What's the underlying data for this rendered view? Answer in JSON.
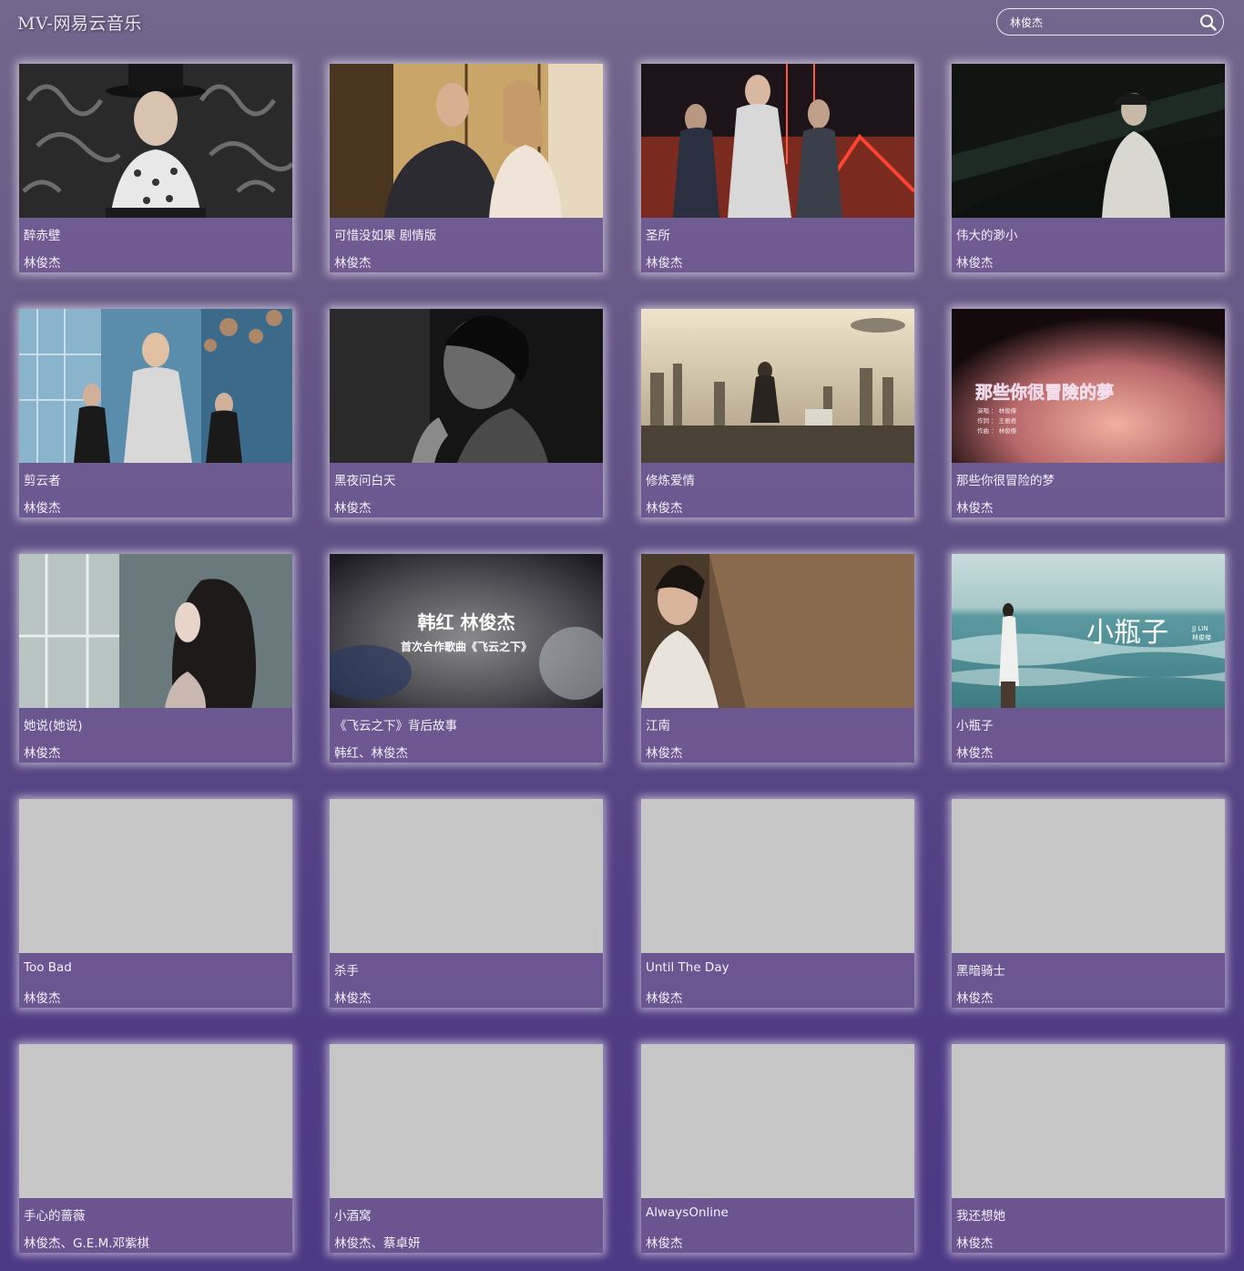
{
  "app": {
    "title": "MV-网易云音乐"
  },
  "search": {
    "value": "林俊杰",
    "placeholder": ""
  },
  "mvs": [
    {
      "title": "醉赤壁",
      "artist": "林俊杰"
    },
    {
      "title": "可惜没如果 剧情版",
      "artist": "林俊杰"
    },
    {
      "title": "圣所",
      "artist": "林俊杰"
    },
    {
      "title": "伟大的渺小",
      "artist": "林俊杰"
    },
    {
      "title": "剪云者",
      "artist": "林俊杰"
    },
    {
      "title": "黑夜问白天",
      "artist": "林俊杰"
    },
    {
      "title": "修炼爱情",
      "artist": "林俊杰"
    },
    {
      "title": "那些你很冒险的梦",
      "artist": "林俊杰",
      "thumb_text": {
        "title": "那些你很冒險的夢",
        "lines": [
          "演唱 ： 林俊傑",
          "作詞 ： 王雅君",
          "作曲 ： 林俊傑"
        ]
      }
    },
    {
      "title": "她说(她说)",
      "artist": "林俊杰"
    },
    {
      "title": "《飞云之下》背后故事",
      "artist": "韩红、林俊杰",
      "thumb_text": {
        "title": "韩红  林俊杰",
        "subtitle": "首次合作歌曲《飞云之下》"
      }
    },
    {
      "title": "江南",
      "artist": "林俊杰"
    },
    {
      "title": "小瓶子",
      "artist": "林俊杰",
      "thumb_text": {
        "title": "小瓶子",
        "side1": "JJ LIN",
        "side2": "林俊傑"
      }
    },
    {
      "title": "Too Bad",
      "artist": "林俊杰"
    },
    {
      "title": "杀手",
      "artist": "林俊杰"
    },
    {
      "title": "Until The Day",
      "artist": "林俊杰"
    },
    {
      "title": "黑暗骑士",
      "artist": "林俊杰"
    },
    {
      "title": "手心的蔷薇",
      "artist": "林俊杰、G.E.M.邓紫棋"
    },
    {
      "title": "小酒窝",
      "artist": "林俊杰、蔡卓妍"
    },
    {
      "title": "AlwaysOnline",
      "artist": "林俊杰"
    },
    {
      "title": "我还想她",
      "artist": "林俊杰"
    }
  ]
}
